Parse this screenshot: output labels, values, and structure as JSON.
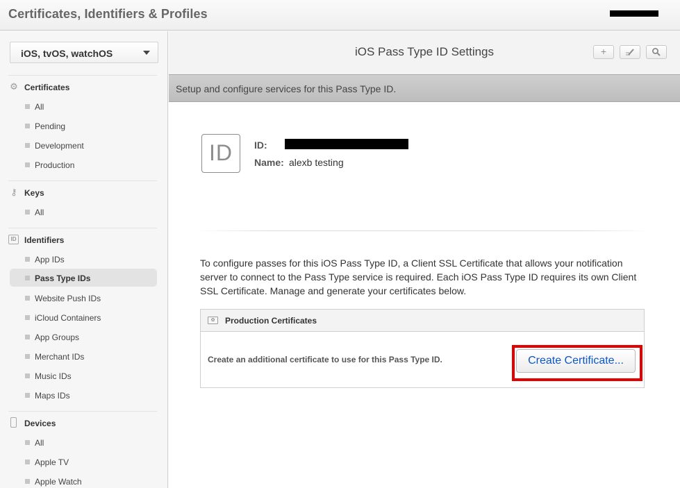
{
  "header": {
    "title": "Certificates, Identifiers & Profiles"
  },
  "sidebar": {
    "platform": "iOS, tvOS, watchOS",
    "sections": {
      "certificates": {
        "label": "Certificates",
        "items": [
          "All",
          "Pending",
          "Development",
          "Production"
        ]
      },
      "keys": {
        "label": "Keys",
        "items": [
          "All"
        ]
      },
      "identifiers": {
        "label": "Identifiers",
        "items": [
          "App IDs",
          "Pass Type IDs",
          "Website Push IDs",
          "iCloud Containers",
          "App Groups",
          "Merchant IDs",
          "Music IDs",
          "Maps IDs"
        ]
      },
      "devices": {
        "label": "Devices",
        "items": [
          "All",
          "Apple TV",
          "Apple Watch"
        ]
      }
    },
    "active_item": "Pass Type IDs"
  },
  "main": {
    "title": "iOS Pass Type ID Settings",
    "toolbar": {
      "add_icon": "plus-icon",
      "edit_icon": "edit-icon",
      "search_icon": "search-icon"
    },
    "subheader": "Setup and configure services for this Pass Type ID.",
    "id_badge": "ID",
    "id_label": "ID:",
    "name_label": "Name:",
    "name_value": "alexb testing",
    "description": "To configure passes for this iOS Pass Type ID, a Client SSL Certificate that allows your notification server to connect to the Pass Type service is required. Each iOS Pass Type ID requires its own Client SSL Certificate. Manage and generate your certificates below.",
    "production_certificates": {
      "title": "Production Certificates",
      "hint": "Create an additional certificate to use for this Pass Type ID.",
      "button": "Create Certificate..."
    }
  },
  "colors": {
    "highlight": "#e60000",
    "button_text": "#0b57c3"
  }
}
